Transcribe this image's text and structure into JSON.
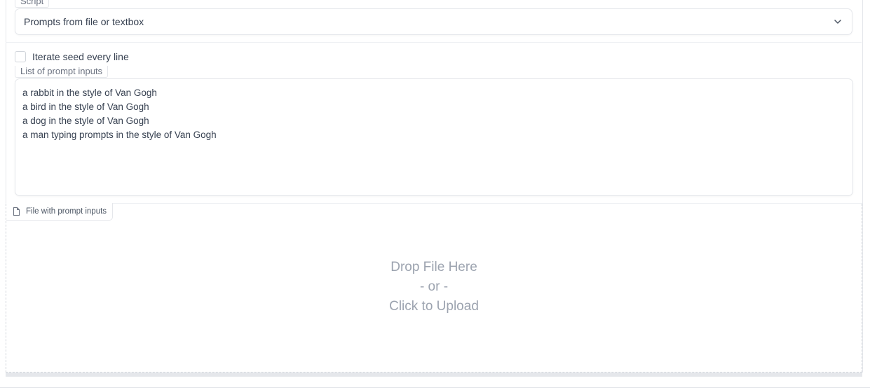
{
  "script": {
    "legend": "Script",
    "selected": "Prompts from file or textbox"
  },
  "iterate_seed": {
    "label": "Iterate seed every line",
    "checked": false
  },
  "prompt_list": {
    "legend": "List of prompt inputs",
    "lines": [
      "a rabbit in the style of Van Gogh",
      "a bird in the style of Van Gogh",
      "a dog in the style of Van Gogh",
      "a man typing prompts in the style of Van Gogh"
    ]
  },
  "file_upload": {
    "label": "File with prompt inputs",
    "icon": "file-icon",
    "drop_text": "Drop File Here",
    "or_text": "- or -",
    "click_text": "Click to Upload"
  }
}
